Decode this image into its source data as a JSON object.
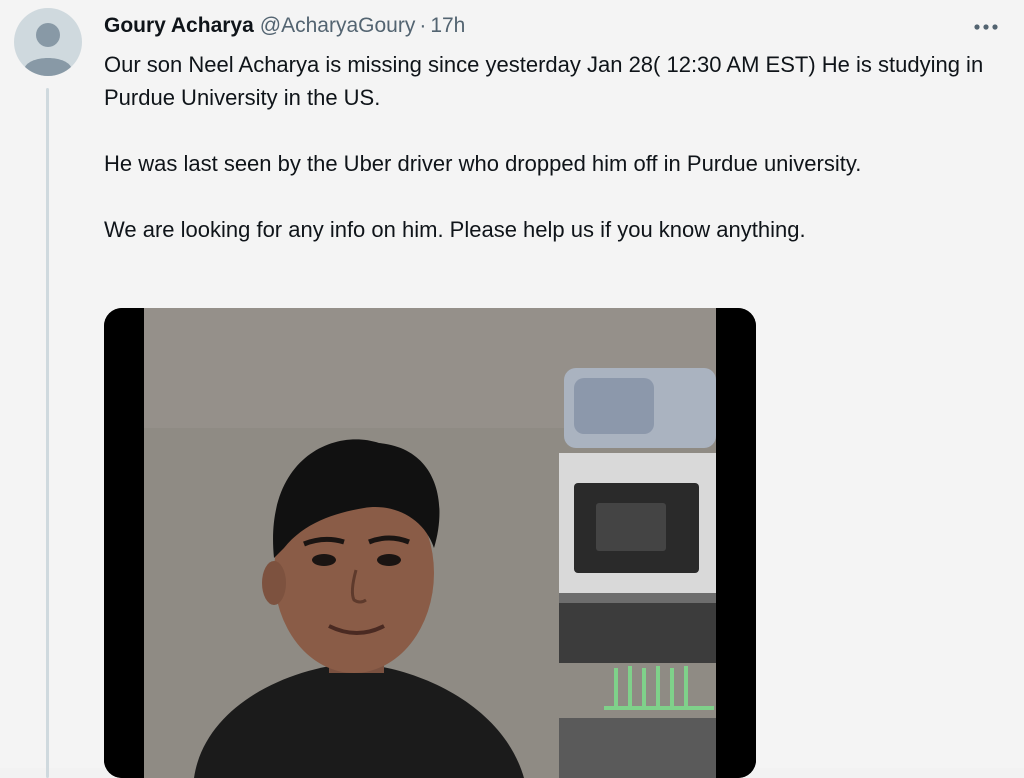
{
  "tweet": {
    "author_name": "Goury Acharya",
    "author_handle": "@AcharyaGoury",
    "separator": "·",
    "time": "17h",
    "more_label": "•••",
    "paragraphs": [
      "Our son Neel Acharya is missing since yesterday Jan 28( 12:30 AM EST) He is studying in Purdue University in the US.",
      "He was last seen by the Uber driver who dropped him off in Purdue university.",
      "We are looking for any info on him. Please help us if you know anything."
    ],
    "media": {
      "kind": "photo"
    }
  },
  "colors": {
    "background": "#f4f4f4",
    "text": "#0f1419",
    "secondary_text": "#536471",
    "avatar_placeholder": "#cfd9de"
  },
  "icons": {
    "avatar": "default-profile-icon",
    "more": "more-options-icon"
  }
}
